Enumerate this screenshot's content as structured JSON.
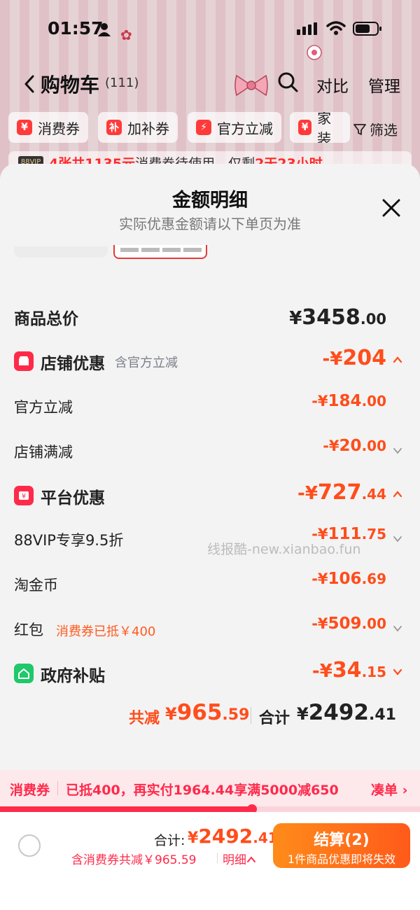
{
  "status_bar": {
    "time": "01:57"
  },
  "nav": {
    "title": "购物车",
    "count": "(111)",
    "compare": "对比",
    "manage": "管理"
  },
  "filters": {
    "chips": [
      {
        "icon": "¥",
        "label": "消费券"
      },
      {
        "icon": "补",
        "label": "加补券"
      },
      {
        "icon": "⚡",
        "label": "官方立减"
      },
      {
        "icon": "¥",
        "label": "家装"
      }
    ],
    "filter_label": "筛选"
  },
  "vip_strip": {
    "badge": "88VIP",
    "prefix": "4张共1135元",
    "middle": "消费券待使用，仅剩",
    "suffix": "2天23小时"
  },
  "sheet": {
    "title": "金额明细",
    "subtitle": "实际优惠金额请以下单页为准",
    "total": {
      "label": "商品总价",
      "symbol": "¥",
      "int": "3458",
      "dec": ".00"
    },
    "store_discount": {
      "label": "店铺优惠",
      "note": "含官方立减",
      "sign": "-¥",
      "int": "204",
      "dec": ""
    },
    "official_cut": {
      "label": "官方立减",
      "sign": "-¥",
      "int": "184",
      "dec": ".00"
    },
    "store_full_cut": {
      "label": "店铺满减",
      "sign": "-¥",
      "int": "20",
      "dec": ".00"
    },
    "platform_discount": {
      "label": "平台优惠",
      "sign": "-¥",
      "int": "727",
      "dec": ".44"
    },
    "vip_discount": {
      "label": "88VIP专享9.5折",
      "sign": "-¥",
      "int": "111",
      "dec": ".75"
    },
    "taojinbi": {
      "label": "淘金币",
      "sign": "-¥",
      "int": "106",
      "dec": ".69"
    },
    "red_packet": {
      "label": "红包",
      "note": "消费券已抵￥400",
      "sign": "-¥",
      "int": "509",
      "dec": ".00"
    },
    "gov_subsidy": {
      "label": "政府补贴",
      "sign": "-¥",
      "int": "34",
      "dec": ".15"
    },
    "summary": {
      "saved_label": "共减",
      "saved_symbol": "¥",
      "saved_int": "965",
      "saved_dec": ".59",
      "total_label": "合计",
      "total_symbol": "¥",
      "total_int": "2492",
      "total_dec": ".41"
    },
    "watermark": "线报酷-new.xianbao.fun"
  },
  "coupon_bar": {
    "title": "消费券",
    "message": "已抵400，再实付1964.44享满5000减650",
    "link": "凑单 ›",
    "progress": 0.6
  },
  "checkout": {
    "total_label": "合计:",
    "total_symbol": "¥",
    "total_int": "2492",
    "total_dec": ".41",
    "discount_text": "含消费券共减￥965.59",
    "detail_link": "明细",
    "button_label": "结算(2)",
    "button_sub": "1件商品优惠即将失效"
  },
  "colors": {
    "accent": "#ff4d1c",
    "coupon_red": "#ff2a4a",
    "store_icon": "#ff2a4a",
    "gov_icon": "#1fc86a"
  }
}
